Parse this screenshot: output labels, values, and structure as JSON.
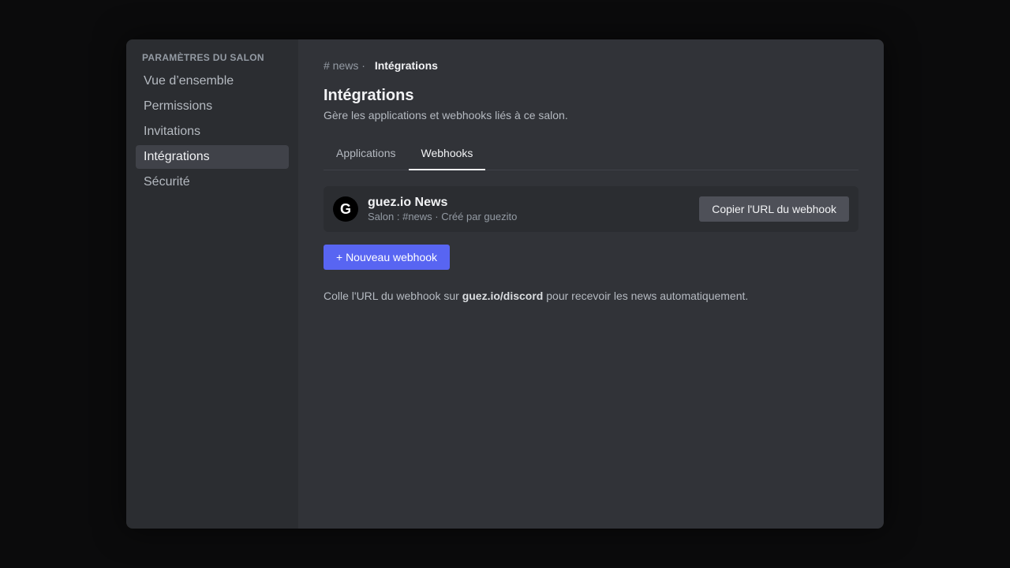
{
  "sidebar": {
    "heading": "PARAMÈTRES DU SALON",
    "items": [
      {
        "label": "Vue d’ensemble"
      },
      {
        "label": "Permissions"
      },
      {
        "label": "Invitations"
      },
      {
        "label": "Intégrations",
        "active": true
      },
      {
        "label": "Sécurité"
      }
    ]
  },
  "breadcrumb": {
    "channel": "# news",
    "separator": "·",
    "current": "Intégrations"
  },
  "header": {
    "title": "Intégrations",
    "description": "Gère les applications et webhooks liés à ce salon."
  },
  "tabs": [
    {
      "label": "Applications",
      "active": false
    },
    {
      "label": "Webhooks",
      "active": true
    }
  ],
  "webhook": {
    "avatar_letter": "G",
    "name": "guez.io News",
    "meta": "Salon : #news · Créé par guezito",
    "copy_button": "Copier l'URL du webhook"
  },
  "new_webhook_button": "+ Nouveau webhook",
  "hint": {
    "before": "Colle l'URL du webhook sur ",
    "link": "guez.io/discord",
    "after": " pour recevoir les news automatiquement."
  },
  "colors": {
    "accent": "#5865f2",
    "sidebar_bg": "#2b2d31",
    "main_bg": "#313338",
    "active_item_bg": "#404249"
  }
}
